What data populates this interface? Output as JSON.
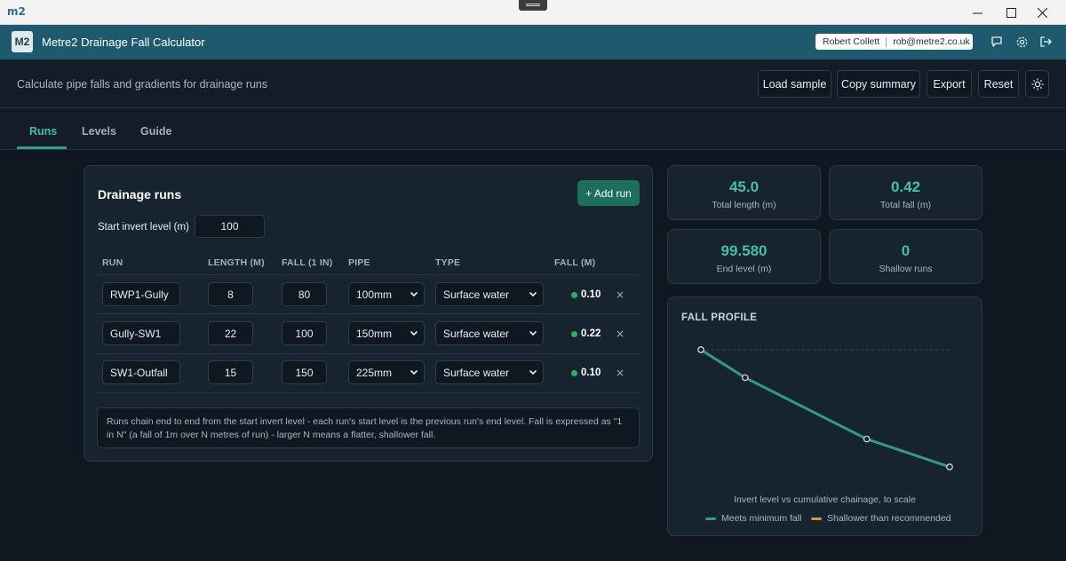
{
  "window": {
    "logo": "m2",
    "minimize_icon": "minimize-icon",
    "maximize_icon": "maximize-icon",
    "close_icon": "close-icon"
  },
  "app": {
    "badge": "M2",
    "title": "Metre2 Drainage Fall Calculator",
    "user_name": "Robert Collett",
    "user_email": "rob@metre2.co.uk",
    "icons": [
      "chat-icon",
      "settings-icon",
      "logout-icon"
    ]
  },
  "toolbar": {
    "subtitle": "Calculate pipe falls and gradients for drainage runs",
    "buttons": [
      "Load sample",
      "Copy summary",
      "Export",
      "Reset"
    ],
    "theme_icon": "sun-icon"
  },
  "tabs": [
    {
      "label": "Runs",
      "active": true
    },
    {
      "label": "Levels",
      "active": false
    },
    {
      "label": "Guide",
      "active": false
    }
  ],
  "runs": {
    "title": "Drainage runs",
    "add_label": "+ Add run",
    "start_label": "Start invert level (m)",
    "start_value": "100",
    "headers": [
      "RUN",
      "LENGTH (M)",
      "FALL (1 IN)",
      "PIPE",
      "TYPE",
      "FALL (M)"
    ],
    "rows": [
      {
        "run": "RWP1-Gully",
        "length": "8",
        "fall_ratio": "80",
        "pipe": "100mm",
        "type": "Surface water",
        "fall_m": "0.10",
        "status_color": "#2fae63"
      },
      {
        "run": "Gully-SW1",
        "length": "22",
        "fall_ratio": "100",
        "pipe": "150mm",
        "type": "Surface water",
        "fall_m": "0.22",
        "status_color": "#2fae63"
      },
      {
        "run": "SW1-Outfall",
        "length": "15",
        "fall_ratio": "150",
        "pipe": "225mm",
        "type": "Surface water",
        "fall_m": "0.10",
        "status_color": "#2fae63"
      }
    ],
    "remove_glyph": "×",
    "note": "Runs chain end to end from the start invert level - each run's start level is the previous run's end level. Fall is expressed as \"1 in N\" (a fall of 1m over N metres of run) - larger N means a flatter, shallower fall."
  },
  "stats": [
    {
      "value": "45.0",
      "label": "Total length (m)"
    },
    {
      "value": "0.42",
      "label": "Total fall (m)"
    },
    {
      "value": "99.580",
      "label": "End level (m)"
    },
    {
      "value": "0",
      "label": "Shallow runs"
    }
  ],
  "profile": {
    "title": "FALL PROFILE",
    "caption": "Invert level vs cumulative chainage, to scale",
    "legend": [
      {
        "label": "Meets minimum fall",
        "color": "#2f9e84"
      },
      {
        "label": "Shallower than recommended",
        "color": "#d99a2b"
      }
    ],
    "chart_data": {
      "type": "line",
      "x": [
        0,
        8,
        30,
        45
      ],
      "y": [
        100.0,
        99.9,
        99.68,
        99.58
      ],
      "series": [
        {
          "values": [
            100.0,
            99.9,
            99.68,
            99.58
          ]
        }
      ],
      "xlabel": "",
      "ylabel": ""
    }
  },
  "colors": {
    "accent": "#43c1a0",
    "brand": "#1e5a6e",
    "ok": "#2fae63",
    "warn": "#d99a2b"
  }
}
